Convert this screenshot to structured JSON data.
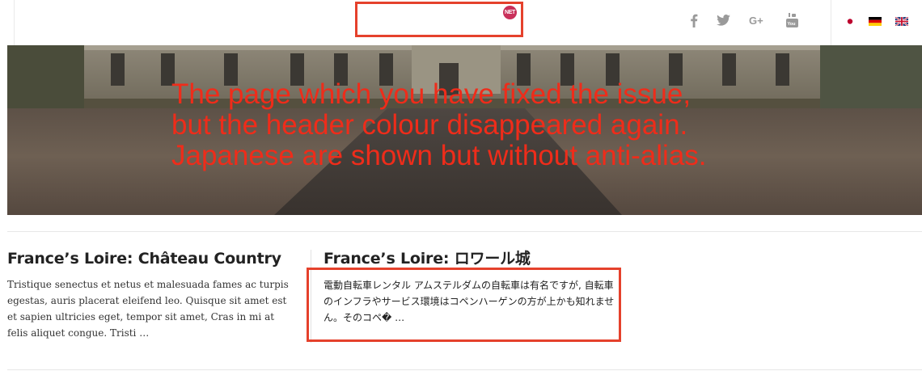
{
  "header": {
    "logo_badge": "NET",
    "social": [
      {
        "name": "facebook-icon",
        "color": "#9a9a9a"
      },
      {
        "name": "twitter-icon",
        "color": "#9a9a9a"
      },
      {
        "name": "google-plus-icon",
        "label": "G+",
        "color": "#9a9a9a"
      },
      {
        "name": "youtube-icon",
        "label": "You",
        "color": "#9a9a9a"
      }
    ],
    "languages": [
      {
        "name": "japanese-flag-icon"
      },
      {
        "name": "german-flag-icon"
      },
      {
        "name": "uk-flag-icon"
      }
    ],
    "annotation_color": "#e5412c"
  },
  "hero": {
    "note_lines": [
      "The page which you have fixed the issue,",
      "but the header colour disappeared again.",
      "Japanese are shown but without anti-alias."
    ],
    "note_color": "#ef2c1a"
  },
  "posts": [
    {
      "title": "France’s Loire: Château Country",
      "excerpt": "Tristique senectus et netus et malesuada fames ac turpis egestas, auris placerat eleifend leo. Quisque sit amet est et sapien ultricies eget, tempor sit amet, Cras in mi at felis aliquet congue. Tristi …"
    },
    {
      "title": "France’s Loire: ロワール城",
      "excerpt": "電動自転車レンタル アムステルダムの自転車は有名ですが, 自転車のインフラやサービス環境はコペンハーゲンの方が上かも知れません。そのコペ� …"
    }
  ]
}
